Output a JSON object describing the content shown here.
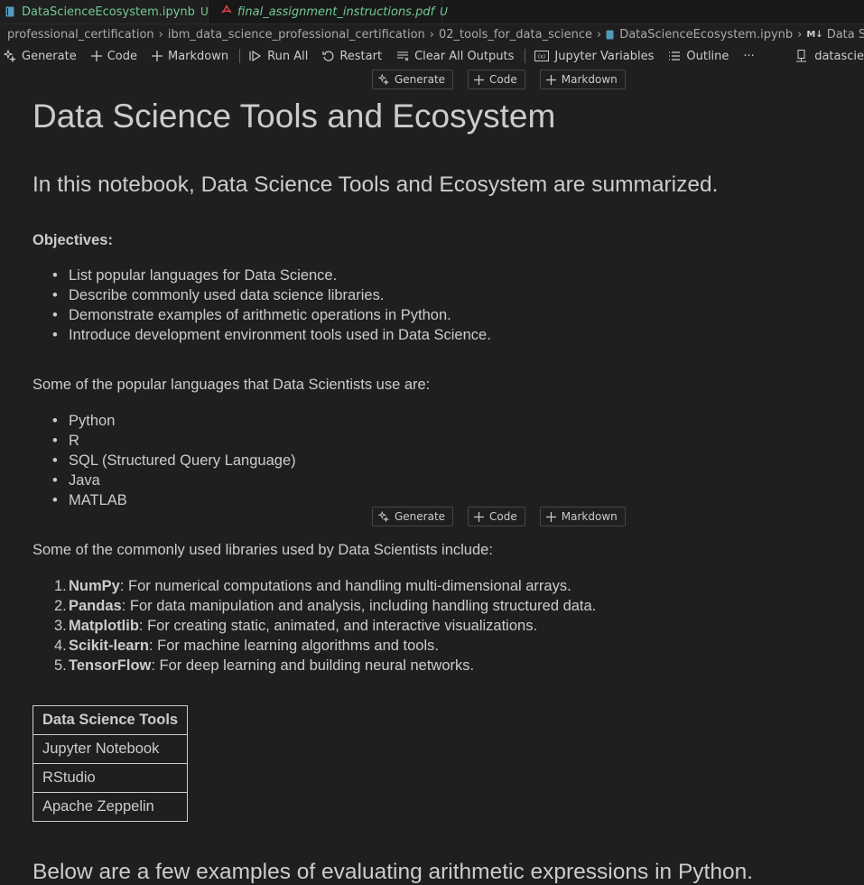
{
  "tabs": [
    {
      "label": "DataScienceEcosystem.ipynb",
      "status": "U",
      "active": true
    },
    {
      "label": "final_assignment_instructions.pdf",
      "status": "U",
      "active": false
    }
  ],
  "breadcrumb": [
    "professional_certification",
    "ibm_data_science_professional_certification",
    "02_tools_for_data_science",
    "DataScienceEcosystem.ipynb",
    "M↓",
    "Data Science Tools and E"
  ],
  "toolbar": {
    "generate": "Generate",
    "code": "Code",
    "markdown": "Markdown",
    "run_all": "Run All",
    "restart": "Restart",
    "clear_all_outputs": "Clear All Outputs",
    "jupyter_variables": "Jupyter Variables",
    "outline": "Outline",
    "more": "···",
    "kernel": "datascie"
  },
  "cell_actions": {
    "generate": "Generate",
    "code": "Code",
    "markdown": "Markdown"
  },
  "notebook": {
    "title": "Data Science Tools and Ecosystem",
    "intro": "In this notebook, Data Science Tools and Ecosystem are summarized.",
    "objectives_label": "Objectives:",
    "objectives": [
      "List popular languages for Data Science.",
      "Describe commonly used data science libraries.",
      "Demonstrate examples of arithmetic operations in Python.",
      "Introduce development environment tools used in Data Science."
    ],
    "languages_intro": "Some of the popular languages that Data Scientists use are:",
    "languages": [
      "Python",
      "R",
      "SQL (Structured Query Language)",
      "Java",
      "MATLAB"
    ],
    "libraries_intro": "Some of the commonly used libraries used by Data Scientists include:",
    "libraries": [
      {
        "num": "1.",
        "name": "NumPy",
        "desc": ": For numerical computations and handling multi-dimensional arrays."
      },
      {
        "num": "2.",
        "name": "Pandas",
        "desc": ": For data manipulation and analysis, including handling structured data."
      },
      {
        "num": "3.",
        "name": "Matplotlib",
        "desc": ": For creating static, animated, and interactive visualizations."
      },
      {
        "num": "4.",
        "name": "Scikit-learn",
        "desc": ": For machine learning algorithms and tools."
      },
      {
        "num": "5.",
        "name": "TensorFlow",
        "desc": ": For deep learning and building neural networks."
      }
    ],
    "tools_table": {
      "header": "Data Science Tools",
      "rows": [
        "Jupyter Notebook",
        "RStudio",
        "Apache Zeppelin"
      ]
    },
    "arithmetic_heading": "Below are a few examples of evaluating arithmetic expressions in Python."
  },
  "colors": {
    "background": "#1f1f1f",
    "text": "#cccccc",
    "untracked_green": "#73c991",
    "pdf_red": "#e04545"
  }
}
